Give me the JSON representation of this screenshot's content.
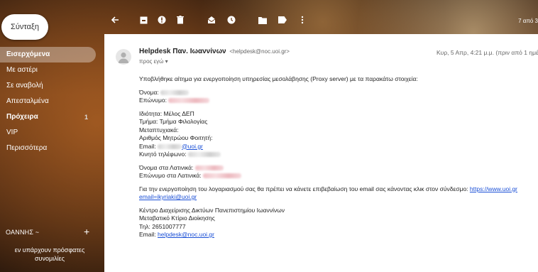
{
  "compose": {
    "label": "Σύνταξη"
  },
  "sidebar": {
    "items": [
      {
        "label": "Εισερχόμενα",
        "bold": true,
        "active": true,
        "count": ""
      },
      {
        "label": "Με αστέρι",
        "bold": false,
        "active": false,
        "count": ""
      },
      {
        "label": "Σε αναβολή",
        "bold": false,
        "active": false,
        "count": ""
      },
      {
        "label": "Απεσταλμένα",
        "bold": false,
        "active": false,
        "count": ""
      },
      {
        "label": "Πρόχειρα",
        "bold": true,
        "active": false,
        "count": "1"
      },
      {
        "label": "VIP",
        "bold": false,
        "active": false,
        "count": ""
      },
      {
        "label": "Περισσότερα",
        "bold": false,
        "active": false,
        "count": ""
      }
    ]
  },
  "hangouts": {
    "title": "ΟΑΝΝΗΣ ~",
    "plus": "+",
    "empty_line1": "εν υπάρχουν πρόσφατες",
    "empty_line2": "συνομιλίες"
  },
  "toolbar": {
    "counter": "7 από 3",
    "icons": [
      "back-arrow-icon",
      "archive-icon",
      "report-spam-icon",
      "delete-icon",
      "mark-unread-icon",
      "snooze-icon",
      "move-to-icon",
      "labels-icon",
      "more-vert-icon"
    ]
  },
  "email": {
    "sender_name": "Helpdesk Παν. Ιωαννίνων",
    "sender_address": "<helpdesk@noc.uoi.gr>",
    "date": "Κυρ, 5 Απρ, 4:21 μ.μ. (πριν από 1 ημέρ",
    "recipients": "προς εγώ ▾",
    "intro": "Υποβλήθηκε αίτημα για ενεργοποίηση υπηρεσίας μεσολάβησης (Proxy server) με τα παρακάτω στοιχεία:",
    "first_name_label": "Όνομα:",
    "last_name_label": "Επώνυμο:",
    "property_line": "Ιδιότητα: Μέλος ΔΕΠ",
    "department_line": "Τμήμα: Τμήμα Φιλολογίας",
    "postgrad_label": "Μεταπτυχιακά:",
    "student_id_label": "Αριθμός Μητρώου Φοιτητή:",
    "email_label": "Email:",
    "email_domain": "@uoi.gr",
    "mobile_label": "Κινητό τηλέφωνο:",
    "latin_first_label": "Όνομα στα Λατινικά:",
    "latin_last_label": "Επώνυμο στα Λατινικά:",
    "activation_text": "Για την ενεργοποίηση του λογαριασμού σας θα πρέπει να κάνετε επιβεβαίωση του email σας κάνοντας κλικ στον σύνδεσμο:",
    "activation_link": "https://www.uoi.gr",
    "activation_link_cont": "email=ikyriaki@uoi.gr",
    "sig_org": "Κέντρο Διαχείρισης Δικτύων Πανεπιστημίου Ιωαννίνων",
    "sig_building": "Μεταβατικό Κτίριο Διοίκησης",
    "sig_phone": "Τηλ: 2651007777",
    "sig_email_label": "Email:",
    "sig_email": "helpdesk@noc.uoi.gr"
  },
  "colors": {
    "link": "#1a4fd6",
    "panel": "#ffffff",
    "sidebar_text": "#ffffff"
  }
}
